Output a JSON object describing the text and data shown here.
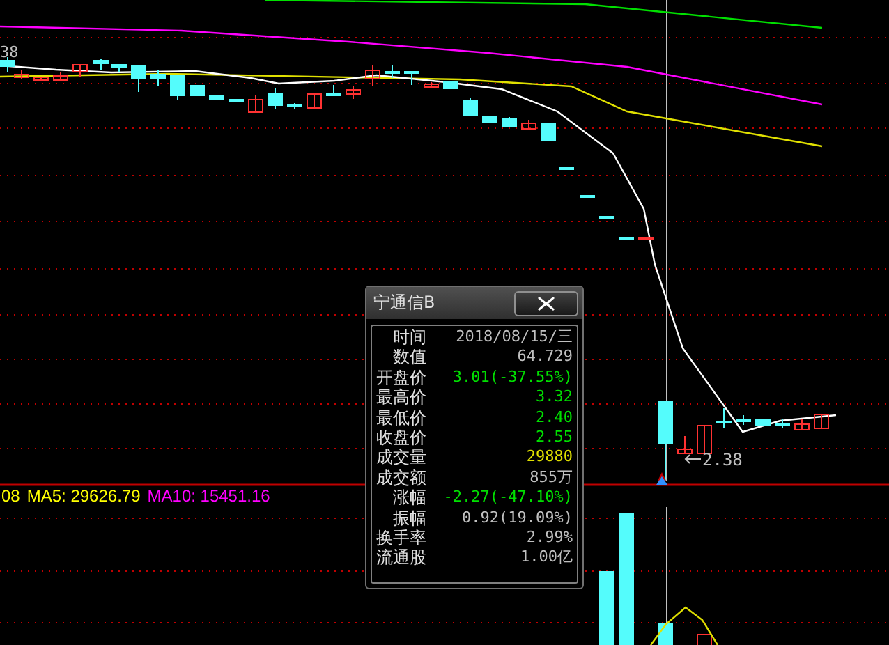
{
  "price_panel": {
    "edge_price_label": "38",
    "low_price_label": "2.38"
  },
  "indicator_bar": {
    "labels": [
      {
        "text": "08",
        "color": "#ffff00"
      },
      {
        "text": "MA5: 29626.79",
        "color": "#ffff00"
      },
      {
        "text": "MA10: 15451.16",
        "color": "#ff00ff"
      }
    ]
  },
  "info_window": {
    "title": "宁通信B",
    "rows": [
      {
        "label": "时间",
        "value": "2018/08/15/三",
        "color": "#c0c0c0"
      },
      {
        "label": "数值",
        "value": "64.729",
        "color": "#c0c0c0"
      },
      {
        "label": "开盘价",
        "value": "3.01(-37.55%)",
        "color": "#00e000"
      },
      {
        "label": "最高价",
        "value": "3.32",
        "color": "#00e000"
      },
      {
        "label": "最低价",
        "value": "2.40",
        "color": "#00e000"
      },
      {
        "label": "收盘价",
        "value": "2.55",
        "color": "#00e000"
      },
      {
        "label": "成交量",
        "value": "29880",
        "color": "#e0e000"
      },
      {
        "label": "成交额",
        "value": "855万",
        "color": "#c0c0c0"
      },
      {
        "label": "涨幅",
        "value": "-2.27(-47.10%)",
        "color": "#00e000"
      },
      {
        "label": "振幅",
        "value": "0.92(19.09%)",
        "color": "#c0c0c0"
      },
      {
        "label": "换手率",
        "value": "2.99%",
        "color": "#c0c0c0"
      },
      {
        "label": "流通股",
        "value": "1.00亿",
        "color": "#c0c0c0"
      }
    ]
  }
}
